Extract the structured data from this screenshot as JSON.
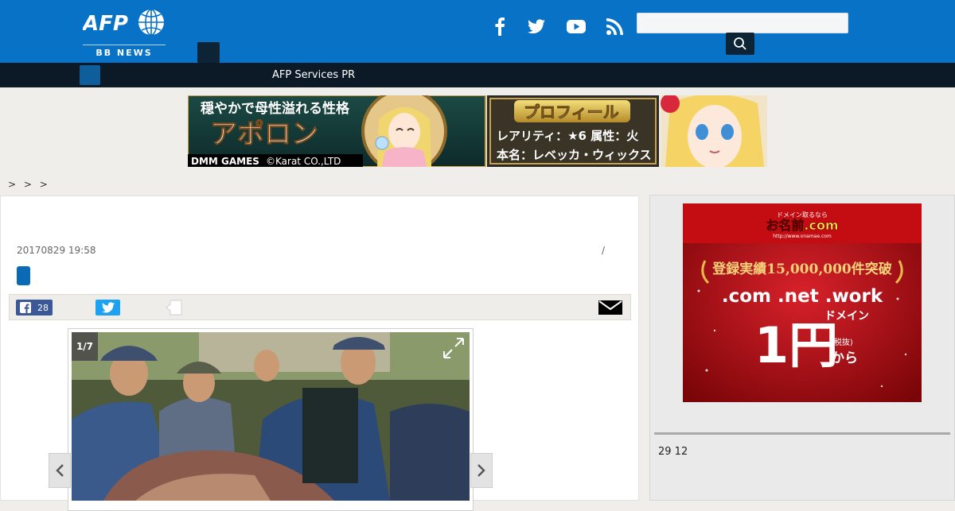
{
  "header": {
    "logo_text": "AFP",
    "logo_sub": "BB NEWS",
    "social_icons": [
      "facebook-icon",
      "twitter-icon",
      "youtube-icon",
      "rss-icon"
    ],
    "search": {
      "placeholder": "",
      "value": ""
    },
    "colors": {
      "header_bg": "#0872c6",
      "dark": "#0c2436",
      "nav_bg": "#0c1a27"
    }
  },
  "nav": {
    "link": "AFP Services PR"
  },
  "banner": {
    "line1": "穏やかで母性溢れる性格",
    "title": "アポロン",
    "dmm": "DMM GAMES",
    "copyright": "©Karat CO.,LTD",
    "profile": "プロフィール",
    "rarity": "レアリティ：★6 属性：火",
    "realname": "本名：レベッカ・ウィックス"
  },
  "breadcrumb": "> > >",
  "article": {
    "date": "20170829 19:58",
    "slash": "/",
    "share": {
      "facebook_count": "28"
    },
    "photo": {
      "counter": "1/7"
    }
  },
  "sidebar_ad": {
    "top1": "ドメイン取るなら",
    "top2": "お名前.com",
    "url": "http://www.onamae.com",
    "badge": "登録実績15,000,000件突破",
    "tlds": ".com .net .work",
    "domain": "ドメイン",
    "price": "1円",
    "tax": "(税抜)",
    "from": "から"
  },
  "sidebar": {
    "text": "29 12"
  }
}
